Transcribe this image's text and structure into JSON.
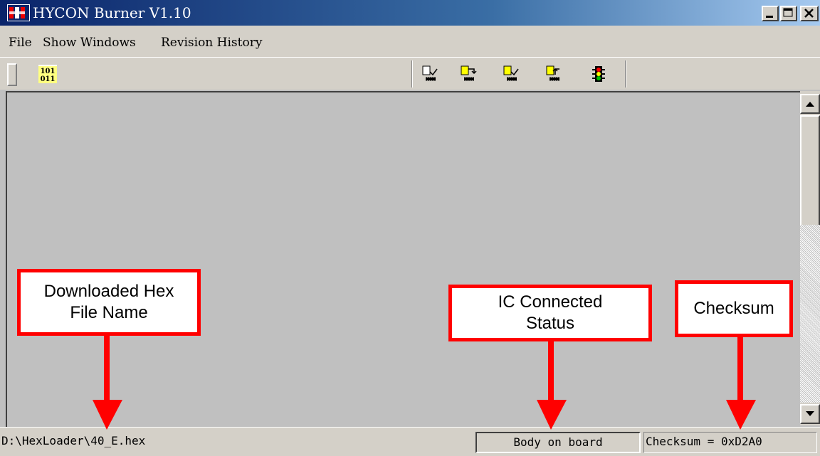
{
  "window": {
    "title": "HYCON Burner V1.10",
    "controls": [
      "minimize-icon",
      "maximize-icon",
      "close-icon"
    ]
  },
  "menu": {
    "items": [
      "File",
      "Show Windows",
      "Revision History"
    ]
  },
  "toolbar": {
    "icons": [
      "binary-file-icon",
      "verify-chip-icon",
      "read-chip-icon",
      "program-chip-icon",
      "upload-chip-icon",
      "traffic-light-icon"
    ],
    "binary_top": "101",
    "binary_bottom": "011"
  },
  "statusbar": {
    "file": "D:\\HexLoader\\40_E.hex",
    "ic_status": "Body on board",
    "checksum": "Checksum = 0xD2A0"
  },
  "annotations": {
    "hex_file": "Downloaded Hex File Name",
    "ic_status": "IC Connected Status",
    "checksum": "Checksum",
    "color": "#ff0000"
  }
}
